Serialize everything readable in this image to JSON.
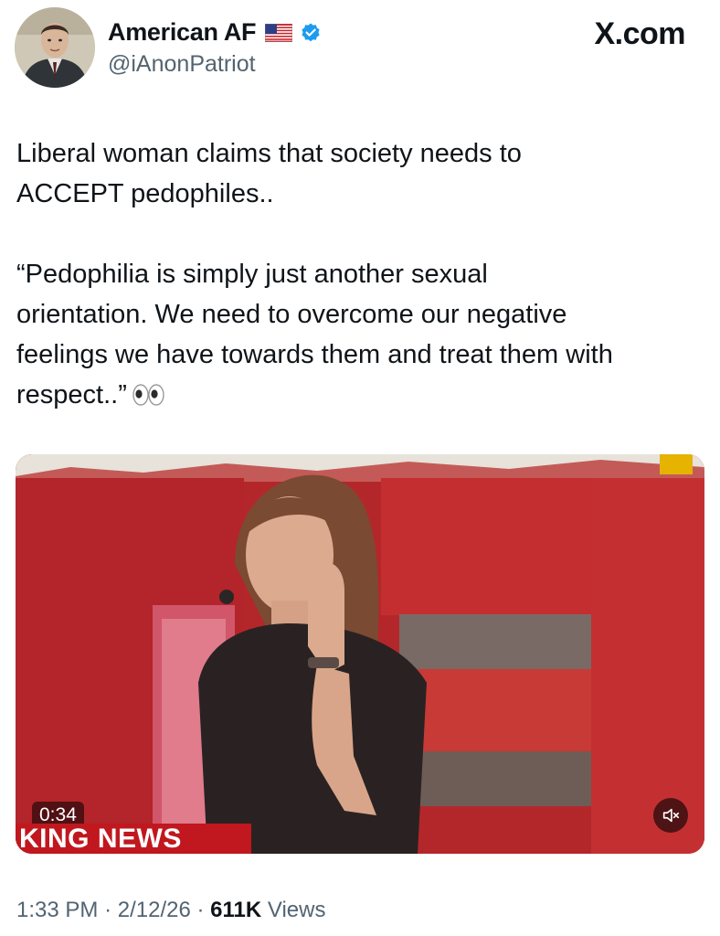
{
  "author": {
    "display_name": "American AF",
    "handle": "@iAnonPatriot",
    "avatar_icon": "profile-photo",
    "flag_icon": "us-flag-icon",
    "verified_icon": "verified-badge-icon"
  },
  "brand": "X.com",
  "tweet": {
    "text": "Liberal woman claims that society needs to\nACCEPT pedophiles..\n\n“Pedophilia is simply just another sexual\norientation. We need to overcome our negative\nfeelings we have towards them and treat them with\nrespect..”",
    "emoji": "eyes-emoji"
  },
  "media": {
    "duration": "0:34",
    "overlay_banner": "KING NEWS",
    "mute_icon": "muted-speaker-icon"
  },
  "meta": {
    "time": "1:33 PM",
    "separator": "·",
    "date": "2/12/26",
    "views_count": "611K",
    "views_label": "Views"
  },
  "colors": {
    "text_primary": "#0f1419",
    "text_secondary": "#536471",
    "verified_blue": "#1d9bf0",
    "banner_red": "#c0181e"
  }
}
